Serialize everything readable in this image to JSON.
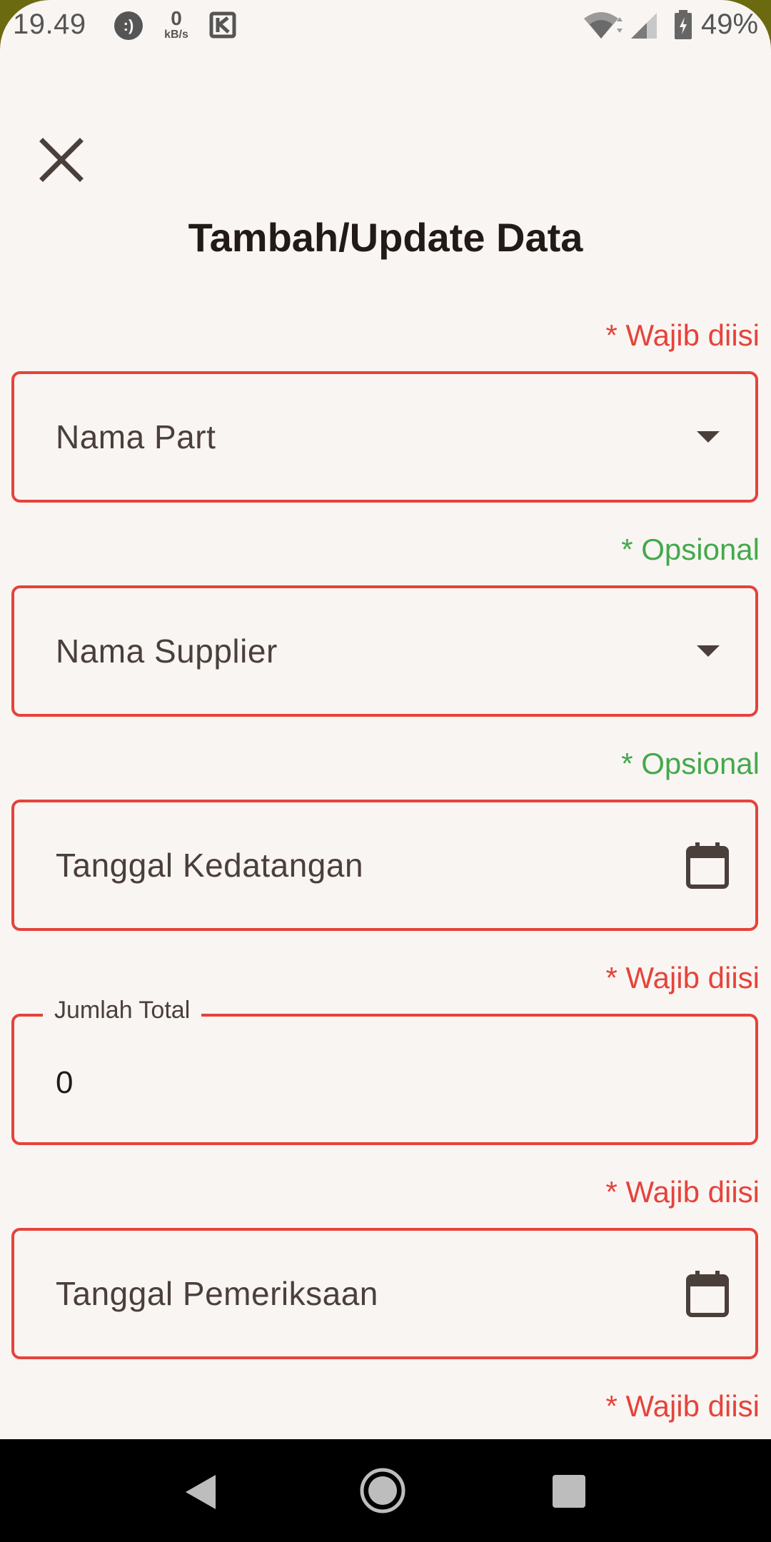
{
  "status_bar": {
    "time": "19.49",
    "net_speed_value": "0",
    "net_speed_unit": "kB/s",
    "battery_percent": "49%",
    "icons": [
      "chat-bubble-icon",
      "k-app-icon",
      "wifi-icon",
      "signal-icon",
      "battery-icon"
    ]
  },
  "header": {
    "title": "Tambah/Update Data",
    "close_icon": "close-icon"
  },
  "form": {
    "fields": [
      {
        "indicator": "* Wajib diisi",
        "label": "Nama Part",
        "type": "dropdown"
      },
      {
        "indicator": "* Opsional",
        "label": "Nama Supplier",
        "type": "dropdown"
      },
      {
        "indicator": "* Opsional",
        "label": "Tanggal Kedatangan",
        "type": "date"
      },
      {
        "indicator": "* Wajib diisi",
        "label": "Jumlah Total",
        "value": "0",
        "type": "number"
      },
      {
        "indicator": "* Wajib diisi",
        "label": "Tanggal Pemeriksaan",
        "type": "date"
      }
    ],
    "trailing_indicator": "* Wajib diisi"
  },
  "colors": {
    "background": "#f9f5f2",
    "required": "#e5433b",
    "optional": "#43a94c",
    "text": "#4a3f3b",
    "title": "#211a17"
  },
  "nav_bar": {
    "icons": [
      "back-icon",
      "home-icon",
      "recents-icon"
    ]
  }
}
